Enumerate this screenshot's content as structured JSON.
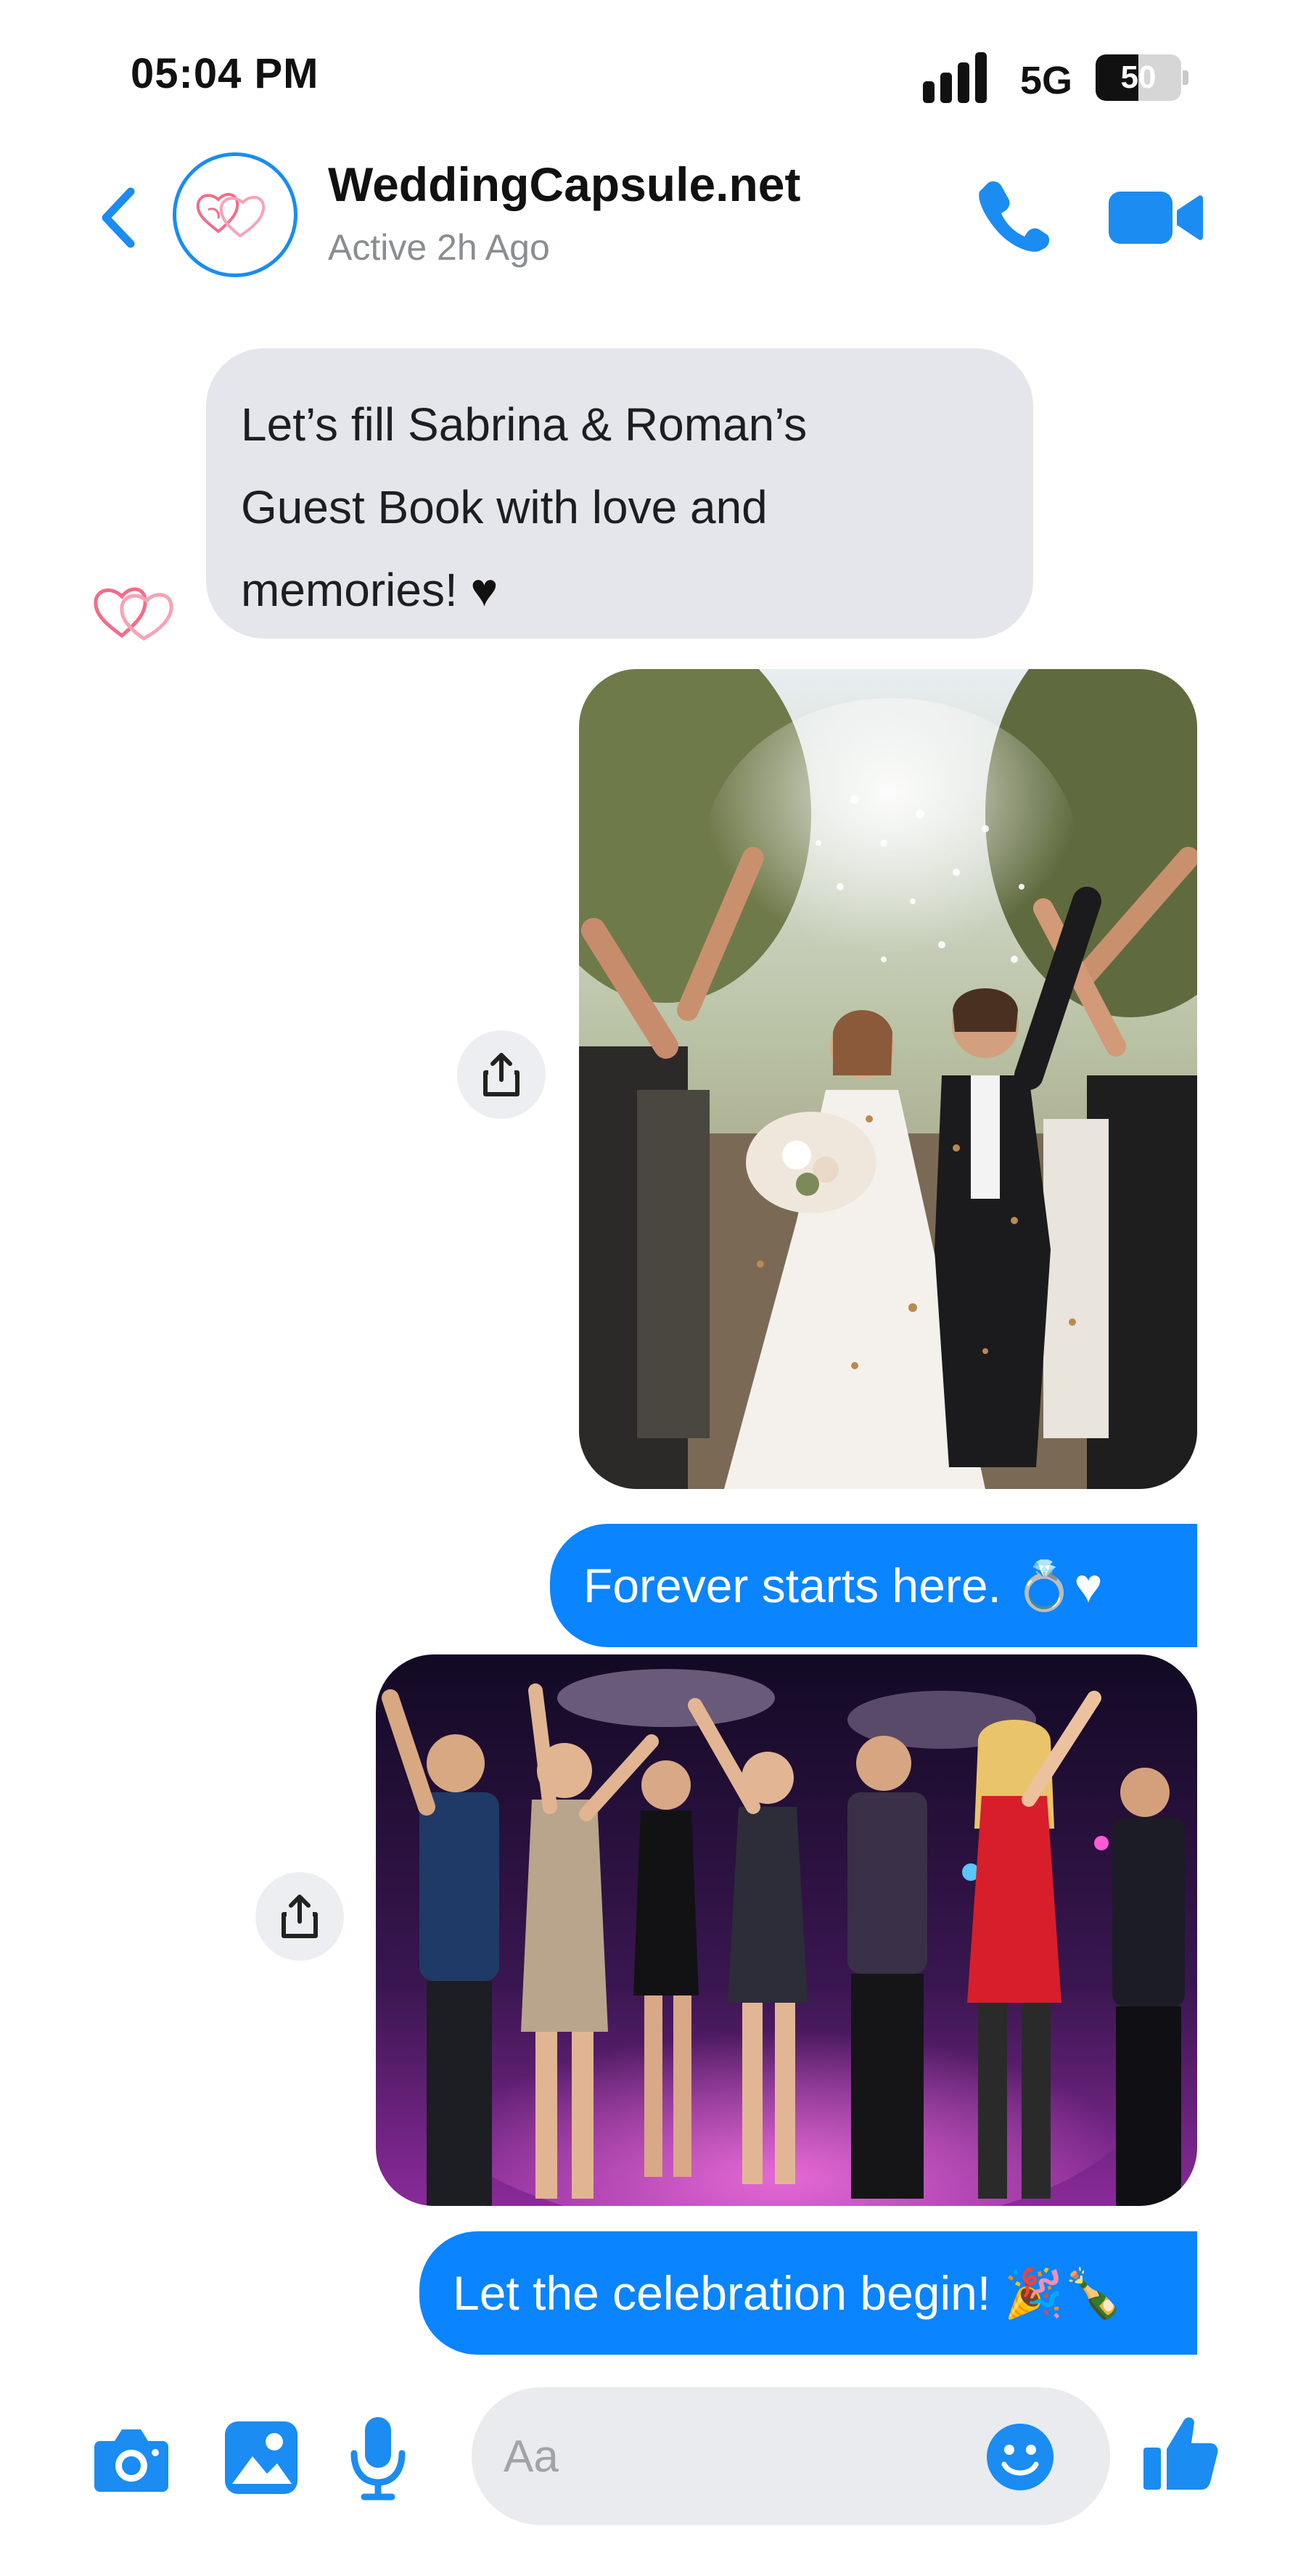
{
  "status_bar": {
    "time": "05:04 PM",
    "network": "5G",
    "battery_text": "50",
    "battery_level": 0.5
  },
  "header": {
    "contact_name": "WeddingCapsule.net",
    "contact_status": "Active 2h Ago",
    "icons": [
      "back-chevron-icon",
      "heart-logo-avatar",
      "phone-icon",
      "video-camera-icon"
    ]
  },
  "messages": [
    {
      "direction": "incoming",
      "type": "text",
      "lines": [
        "Let’s fill Sabrina & Roman’s",
        "Guest Book with love and",
        "memories! "
      ],
      "emoji": "♥"
    },
    {
      "direction": "outgoing",
      "type": "photo",
      "subject": "bride-and-groom-confetti-photo"
    },
    {
      "direction": "outgoing",
      "type": "text",
      "text": "Forever starts here.",
      "emoji": "💍♥"
    },
    {
      "direction": "outgoing",
      "type": "photo",
      "subject": "dance-party-photo"
    },
    {
      "direction": "outgoing",
      "type": "text",
      "text": "Let the celebration begin!",
      "emoji": "🎉🍾"
    }
  ],
  "composer": {
    "placeholder": "Aa",
    "icons": [
      "camera-icon",
      "gallery-icon",
      "microphone-icon",
      "emoji-icon",
      "thumbs-up-icon"
    ]
  },
  "colors": {
    "accent": "#0a84ff",
    "icon_blue": "#1a8cf2",
    "incoming_bubble": "#e4e6eb",
    "composer_field": "#e9ebee",
    "heart_logo": "#f26d8a"
  }
}
